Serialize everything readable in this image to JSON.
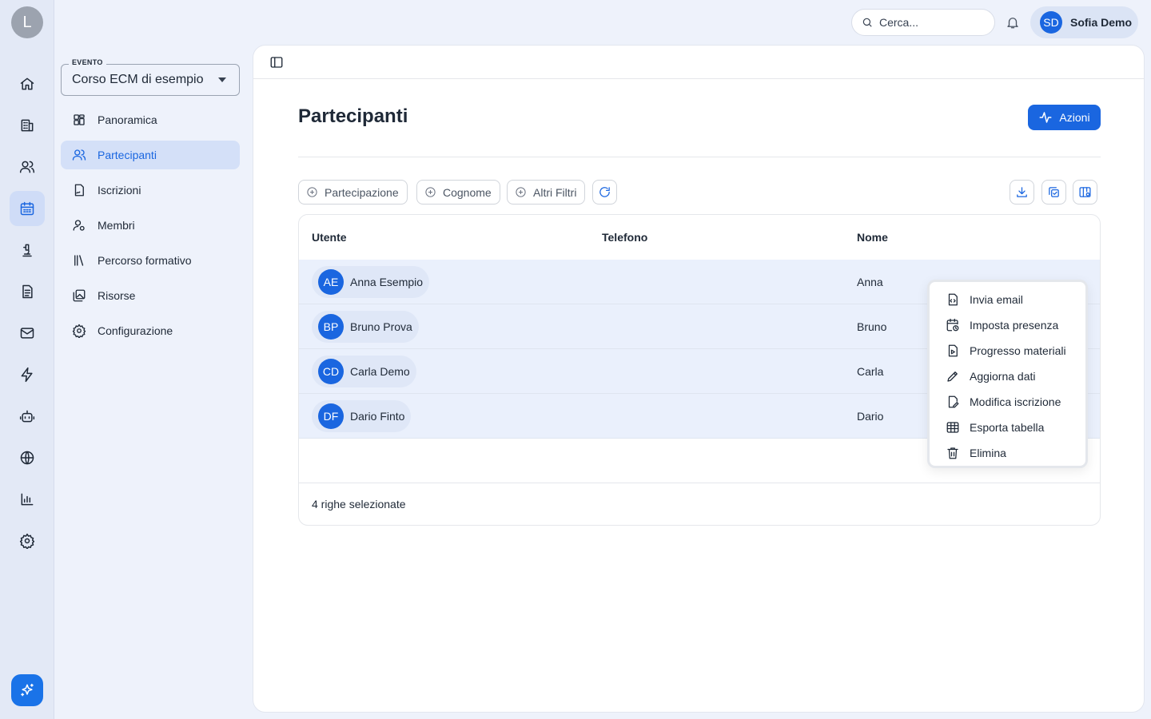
{
  "rail": {
    "avatar_initial": "L",
    "items": [
      {
        "icon": "home-icon"
      },
      {
        "icon": "building-icon"
      },
      {
        "icon": "users-icon"
      },
      {
        "icon": "calendar-icon"
      },
      {
        "icon": "microscope-icon"
      },
      {
        "icon": "document-icon"
      },
      {
        "icon": "mail-icon"
      },
      {
        "icon": "lightning-icon"
      },
      {
        "icon": "bot-icon"
      },
      {
        "icon": "globe-icon"
      },
      {
        "icon": "bar-chart-icon"
      },
      {
        "icon": "gear-icon"
      }
    ],
    "active_item": "calendar-icon",
    "ai_button_icon": "sparkles-icon"
  },
  "topbar": {
    "search_placeholder": "Cerca...",
    "user_initials": "SD",
    "user_name": "Sofia Demo"
  },
  "sidebar": {
    "event_label": "EVENTO",
    "event_value": "Corso ECM di esempio",
    "items": [
      {
        "label": "Panoramica",
        "icon": "dashboard-icon"
      },
      {
        "label": "Partecipanti",
        "icon": "users-icon",
        "active": true
      },
      {
        "label": "Iscrizioni",
        "icon": "file-signature-icon"
      },
      {
        "label": "Membri",
        "icon": "user-settings-icon"
      },
      {
        "label": "Percorso formativo",
        "icon": "library-icon"
      },
      {
        "label": "Risorse",
        "icon": "images-icon"
      },
      {
        "label": "Configurazione",
        "icon": "gear-icon"
      }
    ]
  },
  "main": {
    "title": "Partecipanti",
    "actions_label": "Azioni",
    "filters": [
      "Partecipazione",
      "Cognome",
      "Altri Filtri"
    ],
    "table": {
      "columns": [
        "Utente",
        "Telefono",
        "Nome"
      ],
      "rows": [
        {
          "initials": "AE",
          "user": "Anna Esempio",
          "phone": "",
          "name": "Anna"
        },
        {
          "initials": "BP",
          "user": "Bruno Prova",
          "phone": "",
          "name": "Bruno"
        },
        {
          "initials": "CD",
          "user": "Carla Demo",
          "phone": "",
          "name": "Carla"
        },
        {
          "initials": "DF",
          "user": "Dario Finto",
          "phone": "",
          "name": "Dario"
        }
      ],
      "footer": "4 righe selezionate"
    }
  },
  "context_menu": {
    "items": [
      {
        "label": "Invia email",
        "icon": "file-code-icon"
      },
      {
        "label": "Imposta presenza",
        "icon": "calendar-clock-icon"
      },
      {
        "label": "Progresso materiali",
        "icon": "file-play-icon"
      },
      {
        "label": "Aggiorna dati",
        "icon": "pencil-icon"
      },
      {
        "label": "Modifica iscrizione",
        "icon": "file-edit-icon"
      },
      {
        "label": "Esporta tabella",
        "icon": "table-icon"
      },
      {
        "label": "Elimina",
        "icon": "trash-icon"
      }
    ]
  },
  "colors": {
    "accent": "#1a66e0",
    "rail_bg": "#e3e9f6",
    "page_bg": "#eef2fb",
    "row_selected": "#eaf0fc"
  }
}
